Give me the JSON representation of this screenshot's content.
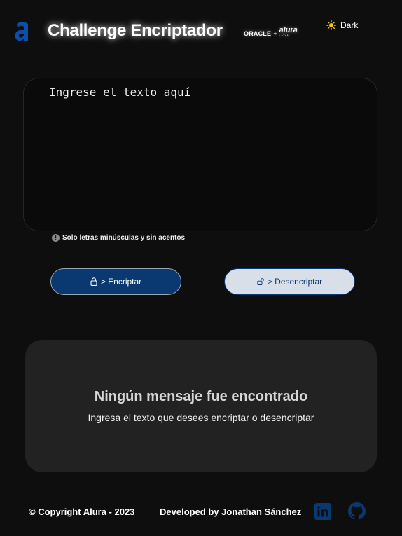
{
  "header": {
    "title": "Challenge Encriptador",
    "partner_oracle": "ORACLE",
    "partner_plus": "+",
    "partner_alura": "alura",
    "partner_alura_sub": "LATAM",
    "theme_label": "Dark",
    "logo_icon": "alura-logo-icon",
    "theme_icon": "sun-icon"
  },
  "input": {
    "placeholder": "Ingrese el texto aquí",
    "value": ""
  },
  "hint": {
    "icon": "info-icon",
    "text": "Solo letras minúsculas y sin acentos"
  },
  "buttons": {
    "encrypt_label": "> Encriptar",
    "encrypt_icon": "lock-icon",
    "decrypt_label": "> Desencriptar",
    "decrypt_icon": "unlock-icon"
  },
  "output": {
    "title": "Ningún mensaje fue encontrado",
    "subtitle": "Ingresa el texto que desees encriptar o desencriptar"
  },
  "footer": {
    "copyright": "© Copyright Alura - 2023",
    "developer": "Developed by Jonathan Sánchez",
    "linkedin_icon": "linkedin-icon",
    "github_icon": "github-icon"
  },
  "colors": {
    "background": "#0e0e0e",
    "accent": "#0a3871",
    "secondary_button": "#d8dfe8",
    "panel": "#222222",
    "logo": "#0b4fa8"
  }
}
